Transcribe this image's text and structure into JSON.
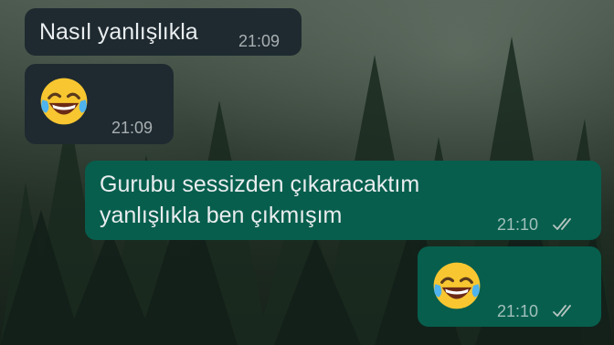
{
  "messages": [
    {
      "direction": "incoming",
      "text": "Nasıl yanlışlıkla",
      "time": "21:09"
    },
    {
      "direction": "incoming",
      "emoji": "face-with-tears-of-joy",
      "time": "21:09"
    },
    {
      "direction": "outgoing",
      "lines": [
        "Gurubu sessizden çıkaracaktım",
        "yanlışlıkla ben çıkmışım"
      ],
      "time": "21:10",
      "status": "read"
    },
    {
      "direction": "outgoing",
      "emoji": "face-with-tears-of-joy",
      "time": "21:10",
      "status": "read"
    }
  ],
  "colors": {
    "incoming_bubble": "#1e2a30",
    "outgoing_bubble": "#075e4d",
    "text": "#e9edef"
  }
}
